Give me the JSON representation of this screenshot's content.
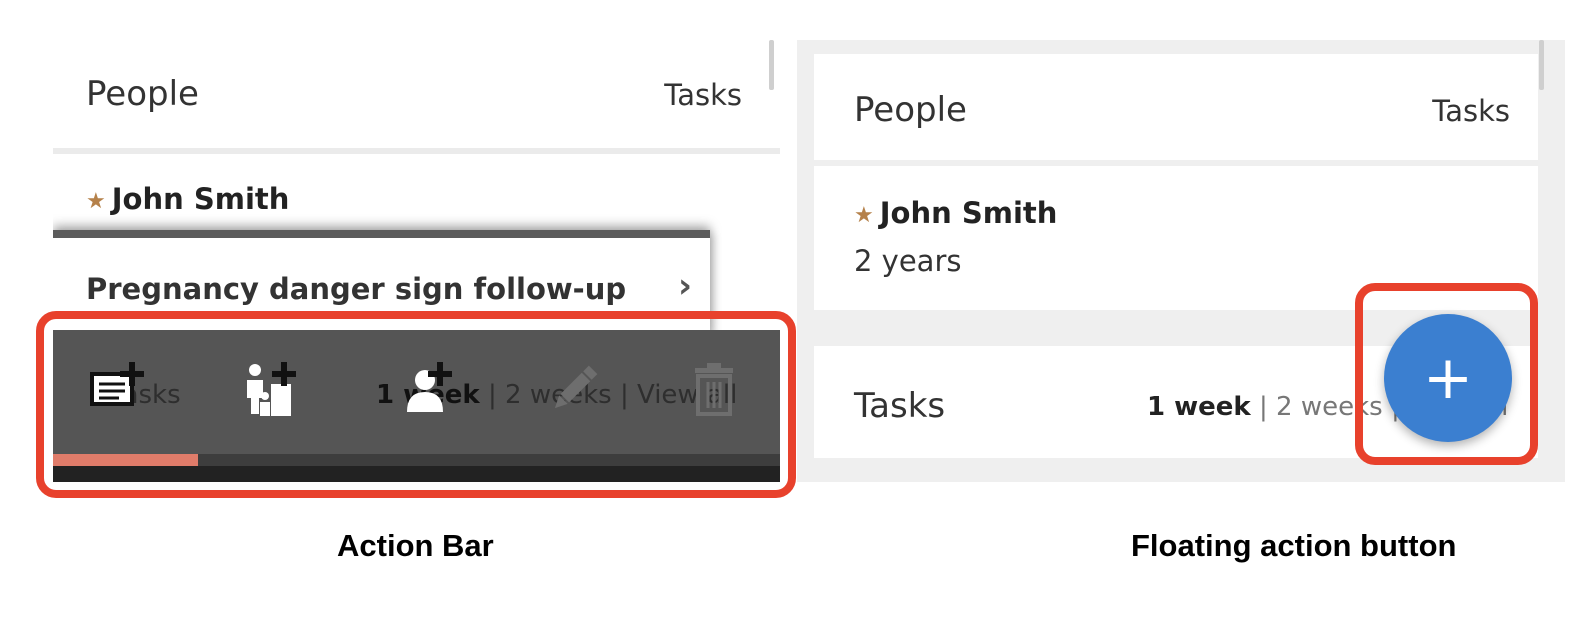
{
  "left_panel": {
    "header": {
      "title": "People",
      "tasks_link": "Tasks"
    },
    "person": {
      "name": "John Smith"
    },
    "task": {
      "title": "Pregnancy danger sign follow-up"
    },
    "tasks_behind": {
      "label": "Tasks",
      "range_active": "1 week",
      "range_rest": " | 2 weeks | View all"
    },
    "action_bar": {
      "actions": [
        "new-report-icon",
        "add-household-icon",
        "add-person-icon",
        "edit-icon",
        "delete-icon"
      ],
      "progress": 0.2
    },
    "caption": "Action Bar"
  },
  "right_panel": {
    "header": {
      "title": "People",
      "tasks_link": "Tasks"
    },
    "person": {
      "name": "John Smith",
      "age": "2 years"
    },
    "tasks": {
      "title": "Tasks",
      "range_active": "1 week",
      "range_rest": " | 2 weeks | View all"
    },
    "fab": {
      "label": "+"
    },
    "caption": "Floating action button"
  },
  "colors": {
    "highlight": "#e8412c",
    "fab": "#3b7fd0",
    "action_bar": "#555555",
    "progress": "#e07c6a",
    "star": "#b5814a"
  }
}
